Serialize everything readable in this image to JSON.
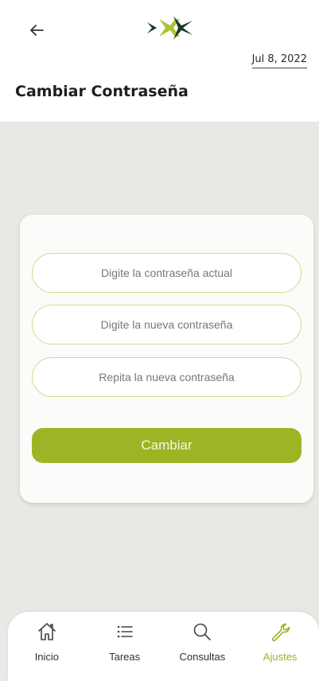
{
  "header": {
    "date": "Jul 8, 2022",
    "title": "Cambiar Contraseña",
    "back_icon": "arrow-left-icon",
    "logo_icon": "brand-logo"
  },
  "form": {
    "current_password_placeholder": "Digite la contraseña actual",
    "new_password_placeholder": "Digite la nueva contraseña",
    "repeat_password_placeholder": "Repita la nueva contraseña",
    "submit_label": "Cambiar"
  },
  "nav": {
    "items": [
      {
        "label": "Inicio",
        "icon": "home-icon",
        "active": false
      },
      {
        "label": "Tareas",
        "icon": "list-icon",
        "active": false
      },
      {
        "label": "Consultas",
        "icon": "search-icon",
        "active": false
      },
      {
        "label": "Ajustes",
        "icon": "wrench-icon",
        "active": true
      }
    ]
  },
  "colors": {
    "accent": "#9db424",
    "field_border": "#cfdc8a",
    "logo_dark": "#1c3a22",
    "logo_light": "#a9c43a",
    "background": "#e8e9e5"
  }
}
